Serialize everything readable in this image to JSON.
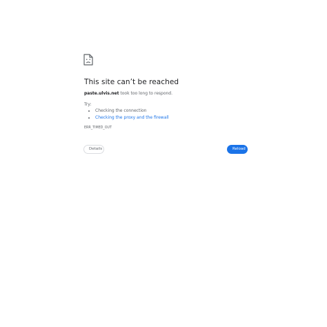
{
  "error": {
    "icon": "sad-page-icon",
    "title": "This site can’t be reached",
    "host": "paste.ulvis.net",
    "message_suffix": " took too long to respond.",
    "try_label": "Try:",
    "suggestions": [
      {
        "text": "Checking the connection",
        "is_link": false
      },
      {
        "text": "Checking the proxy and the firewall",
        "is_link": true
      }
    ],
    "error_code": "ERR_TIMED_OUT"
  },
  "buttons": {
    "details_label": "Details",
    "reload_label": "Reload"
  },
  "colors": {
    "accent": "#1a73e8",
    "text_primary": "#202124",
    "text_secondary": "#5f6368",
    "border": "#dadce0"
  }
}
